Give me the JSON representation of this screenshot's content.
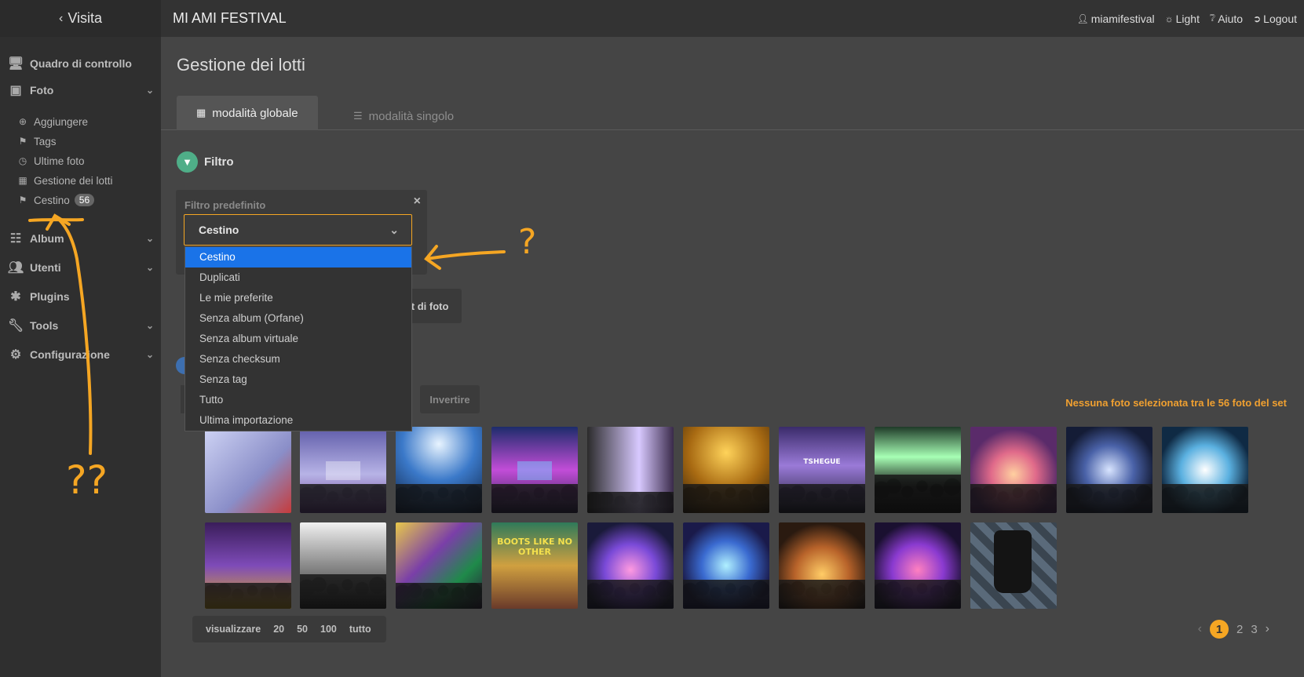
{
  "topbar": {
    "back_label": "Visita",
    "site_title": "MI AMI FESTIVAL",
    "user": "miamifestival",
    "theme": "Light",
    "help": "Aiuto",
    "logout": "Logout"
  },
  "sidebar": {
    "dashboard": "Quadro di controllo",
    "photos": "Foto",
    "photo_items": [
      "Aggiungere",
      "Tags",
      "Ultime foto",
      "Gestione dei lotti",
      "Cestino"
    ],
    "trash_count": "56",
    "albums": "Album",
    "users": "Utenti",
    "plugins": "Plugins",
    "tools": "Tools",
    "config": "Configurazione"
  },
  "main": {
    "page_title": "Gestione dei lotti",
    "tab_global": "modalità globale",
    "tab_single": "modalità singolo",
    "filter_title": "Filtro",
    "predefined_label": "Filtro predefinito",
    "select_value": "Cestino",
    "options": [
      "Cestino",
      "Duplicati",
      "Le mie preferite",
      "Senza album (Orfane)",
      "Senza album virtuale",
      "Senza checksum",
      "Senza tag",
      "Tutto",
      "Ultima importazione"
    ],
    "set_button": "et di foto",
    "invert_button": "Invertire",
    "selection_info": "Nessuna foto selezionata tra le 56 foto del set",
    "thumb_text": "BOOTS LIKE NO OTHER",
    "thumb_label": "TSHEGUE",
    "view_label": "visualizzare",
    "view_options": [
      "20",
      "50",
      "100",
      "tutto"
    ],
    "pages": [
      "1",
      "2",
      "3"
    ]
  },
  "annotations": {
    "q1": "?",
    "q2": "??"
  },
  "colors": {
    "accent": "#f5a623",
    "highlight": "#1a73e8",
    "filter_icon": "#4fae88"
  }
}
